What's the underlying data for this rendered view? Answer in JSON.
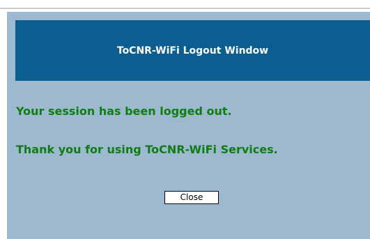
{
  "window": {
    "title": "ToCNR-WiFi Logout Window"
  },
  "messages": {
    "logged_out": "Your session has been logged out.",
    "thanks": "Thank you for using ToCNR-WiFi Services."
  },
  "actions": {
    "close_label": "Close"
  },
  "colors": {
    "header_bg": "#0b5e8f",
    "panel_bg": "#9db9cf",
    "message_text": "#0f7d0f",
    "header_text": "#ffffff"
  }
}
